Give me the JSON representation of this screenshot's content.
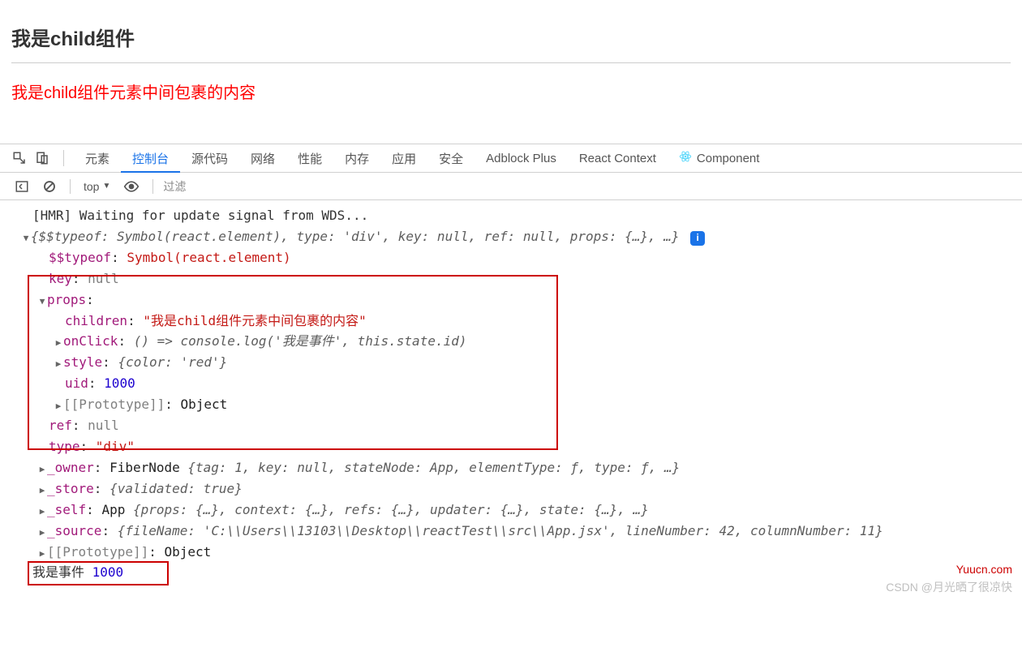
{
  "page": {
    "title": "我是child组件",
    "red_text": "我是child组件元素中间包裹的内容"
  },
  "tabs": {
    "elements": "元素",
    "console": "控制台",
    "sources": "源代码",
    "network": "网络",
    "performance": "性能",
    "memory": "内存",
    "application": "应用",
    "security": "安全",
    "adblock": "Adblock Plus",
    "react_context": "React Context",
    "components": "Component"
  },
  "toolbar": {
    "context": "top",
    "filter_placeholder": "过滤"
  },
  "log": {
    "hmr": "[HMR] Waiting for update signal from WDS...",
    "summary": {
      "open": "{",
      "typeof_k": "$$typeof:",
      "typeof_v": " Symbol(react.element)",
      "type_k": ", type:",
      "type_v": " 'div'",
      "key_k": ", key:",
      "key_v": " null",
      "ref_k": ", ref:",
      "ref_v": " null",
      "props_k": ", props:",
      "props_v": " {…}",
      "rest": ", …}"
    },
    "typeof_k": "$$typeof",
    "typeof_v": "Symbol(react.element)",
    "key_k": "key",
    "key_null": "null",
    "props_k": "props",
    "children_k": "children",
    "children_v": "\"我是child组件元素中间包裹的内容\"",
    "onclick_k": "onClick",
    "onclick_v": "() => console.log('我是事件', this.state.id)",
    "style_k": "style",
    "style_open": "{",
    "style_color_k": "color:",
    "style_color_v": " 'red'",
    "style_close": "}",
    "uid_k": "uid",
    "uid_v": "1000",
    "proto_k": "[[Prototype]]",
    "proto_v": "Object",
    "ref_k": "ref",
    "ref_v": "null",
    "type_k": "type",
    "type_v": "\"div\"",
    "owner_k": "_owner",
    "owner_pre": "FiberNode ",
    "owner_open": "{",
    "owner_tag_k": "tag:",
    "owner_tag_v": " 1",
    "owner_key_k": ", key:",
    "owner_key_v": " null",
    "owner_sn_k": ", stateNode:",
    "owner_sn_v": " App",
    "owner_et_k": ", elementType:",
    "owner_et_v": " ƒ",
    "owner_t_k": ", type:",
    "owner_t_v": " ƒ",
    "owner_rest": ", …}",
    "store_k": "_store",
    "store_v": "{validated: ",
    "store_true": "true",
    "store_close": "}",
    "self_k": "_self",
    "self_pre": "App ",
    "self_open": "{",
    "self_props_k": "props:",
    "self_props_v": " {…}",
    "self_ctx_k": ", context:",
    "self_ctx_v": " {…}",
    "self_refs_k": ", refs:",
    "self_refs_v": " {…}",
    "self_upd_k": ", updater:",
    "self_upd_v": " {…}",
    "self_state_k": ", state:",
    "self_state_v": " {…}",
    "self_rest": ", …}",
    "source_k": "_source",
    "source_open": "{",
    "source_fn_k": "fileName:",
    "source_fn_v": " 'C:\\\\Users\\\\13103\\\\Desktop\\\\reactTest\\\\src\\\\App.jsx'",
    "source_ln_k": ", lineNumber:",
    "source_ln_v": " 42",
    "source_cn_k": ", columnNumber:",
    "source_cn_v": " 11",
    "source_close": "}",
    "event_text": "我是事件 ",
    "event_num": "1000"
  },
  "info_badge": "i",
  "watermark": "Yuucn.com",
  "csdn": "CSDN @月光晒了很凉快"
}
